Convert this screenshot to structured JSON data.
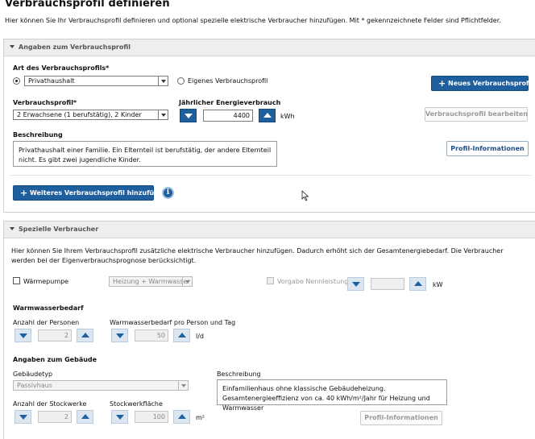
{
  "page": {
    "title": "Verbrauchsprofil definieren",
    "intro": "Hier können Sie Ihr Verbrauchsprofil definieren und optional spezielle elektrische Verbraucher hinzufügen. Mit * gekennzeichnete Felder sind Pflichtfelder."
  },
  "profile_panel": {
    "title": "Angaben zum Verbrauchsprofil",
    "type_label": "Art des Verbrauchsprofils*",
    "type_option_household": "Privathaushalt",
    "type_option_own": "Eigenes Verbrauchsprofil",
    "new_profile_button": "Neues Verbrauchsprofil",
    "profile_label": "Verbrauchsprofil*",
    "profile_value": "2 Erwachsene (1 berufstätig), 2 Kinder",
    "energy_label": "Jährlicher Energieverbrauch",
    "energy_value": "4400",
    "energy_unit": "kWh",
    "edit_profile_button": "Verbrauchsprofil bearbeiten",
    "description_label": "Beschreibung",
    "description_text": "Privathaushalt einer Familie. Ein Elternteil ist berufstätig, der andere Elternteil nicht. Es gibt zwei jugendliche Kinder.",
    "profile_info_button": "Profil-Informationen",
    "add_profile_button": "Weiteres Verbrauchsprofil hinzufügen",
    "info_icon_glyph": "i"
  },
  "consumers_panel": {
    "title": "Spezielle Verbraucher",
    "intro": "Hier können Sie Ihrem Verbrauchsprofil zusätzliche elektrische Verbraucher hinzufügen. Dadurch erhöht sich der Gesamtenergiebedarf. Die Verbraucher werden bei der Eigenverbrauchsprognose berücksichtigt.",
    "heatpump_label": "Wärmepumpe",
    "heatpump_select_value": "Heizung + Warmwasser",
    "nominal_power_label": "Vorgabe Nennleistung",
    "nominal_power_value": "",
    "nominal_power_unit": "kW",
    "hot_water_heading": "Warmwasserbedarf",
    "persons_label": "Anzahl der Personen",
    "persons_value": "2",
    "water_per_person_label": "Warmwasserbedarf pro Person und Tag",
    "water_per_person_value": "50",
    "water_unit": "l/d",
    "building_heading": "Angaben zum Gebäude",
    "building_type_label": "Gebäudetyp",
    "building_type_value": "Passivhaus",
    "building_desc_label": "Beschreibung",
    "building_desc_text": "Einfamilienhaus ohne klassische Gebäudeheizung. Gesamtenergieeffizienz von ca. 40 kWh/m²/Jahr für Heizung und Warmwasser",
    "floors_label": "Anzahl der Stockwerke",
    "floors_value": "2",
    "floor_area_label": "Stockwerkfläche",
    "floor_area_value": "100",
    "floor_area_unit": "m²",
    "profile_info_button": "Profil-Informationen"
  },
  "colors": {
    "accent": "#1f5f9e",
    "panel_header": "#eeeeee"
  }
}
